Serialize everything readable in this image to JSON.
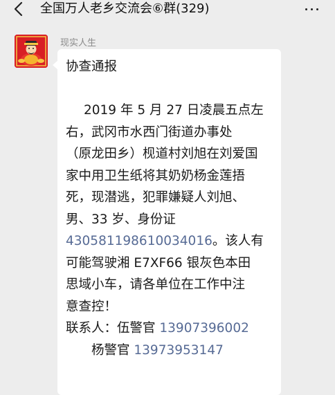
{
  "header": {
    "back_icon": "chevron-left-icon",
    "title": "全国万人老乡交流会⑥群(329)",
    "more_icon": "ellipsis-icon"
  },
  "message": {
    "sender": "现实人生",
    "avatar_icon": "god-of-wealth-avatar",
    "heading": "协查通报",
    "body_lines": [
      "2019 年 5 月 27 日凌晨五点左",
      "右，武冈市水西门街道办事处",
      "（原龙田乡）枧道村刘旭在刘爱国",
      "家中用卫生纸将其奶奶杨金莲捂",
      "死，现潜逃，犯罪嫌疑人刘旭、",
      "男、33 岁、身份证"
    ],
    "id_number": "430581198610034016",
    "id_suffix": "。该人有",
    "body_lines_after": [
      "可能驾驶湘 E7XF66 银灰色本田",
      "思域小车，请各单位在工作中注",
      "意查控！"
    ],
    "contact_label": "联系人：伍警官 ",
    "contact_phone_1": "13907396002",
    "contact_name_2": "杨警官 ",
    "contact_phone_2": "13973953147"
  },
  "colors": {
    "background": "#ededed",
    "bubble": "#ffffff",
    "link": "#576b95",
    "sender_name": "#8a8a8a"
  }
}
